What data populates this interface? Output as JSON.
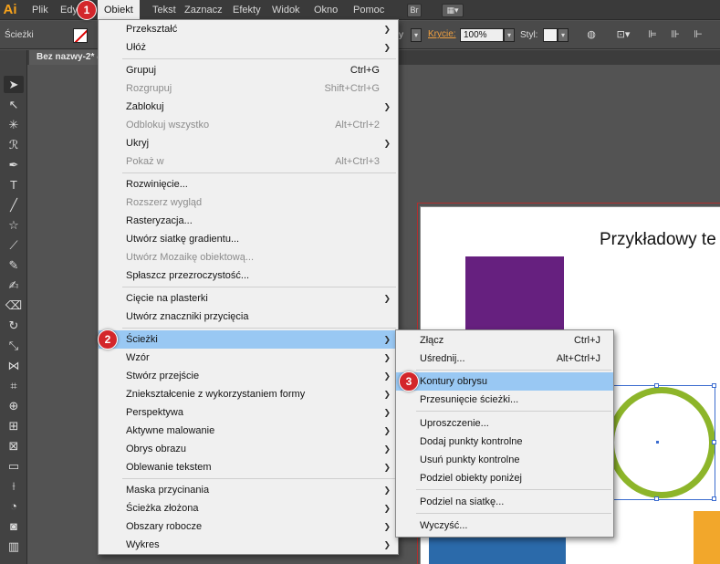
{
  "app": {
    "logo": "Ai"
  },
  "menubar": {
    "items": [
      "Plik",
      "Edy",
      "Obiekt",
      "Tekst",
      "Zaznacz",
      "Efekty",
      "Widok",
      "Okno",
      "Pomoc"
    ],
    "br_label": "Br"
  },
  "control_bar": {
    "mode_label": "Ścieżki",
    "opacity_label": "Krycie:",
    "opacity_value": "100%",
    "style_label": "Styl:",
    "y_fragment": "y"
  },
  "document": {
    "tab_title": "Bez nazwy-2* @"
  },
  "artboard": {
    "sample_text": "Przykładowy te"
  },
  "colors": {
    "purple": "#66207f",
    "green_ring": "#8db52a",
    "blue": "#2b6aaa",
    "orange": "#f2a72b",
    "menu_highlight": "#99c8f3",
    "badge": "#d3262b"
  },
  "badges": [
    "1",
    "2",
    "3"
  ],
  "object_menu": [
    {
      "label": "Przekształć",
      "submenu": true
    },
    {
      "label": "Ułóż",
      "submenu": true
    },
    {
      "label": "Grupuj",
      "shortcut": "Ctrl+G"
    },
    {
      "label": "Rozgrupuj",
      "shortcut": "Shift+Ctrl+G",
      "disabled": true
    },
    {
      "label": "Zablokuj",
      "submenu": true
    },
    {
      "label": "Odblokuj wszystko",
      "shortcut": "Alt+Ctrl+2",
      "disabled": true
    },
    {
      "label": "Ukryj",
      "submenu": true
    },
    {
      "label": "Pokaż w",
      "shortcut": "Alt+Ctrl+3",
      "disabled": true
    },
    {
      "label": "Rozwinięcie..."
    },
    {
      "label": "Rozszerz wygląd",
      "disabled": true
    },
    {
      "label": "Rasteryzacja..."
    },
    {
      "label": "Utwórz siatkę gradientu..."
    },
    {
      "label": "Utwórz Mozaikę obiektową...",
      "disabled": true
    },
    {
      "label": "Spłaszcz przezroczystość..."
    },
    {
      "label": "Cięcie na plasterki",
      "submenu": true
    },
    {
      "label": "Utwórz znaczniki przycięcia"
    },
    {
      "label": "Ścieżki",
      "submenu": true,
      "highlighted": true
    },
    {
      "label": "Wzór",
      "submenu": true
    },
    {
      "label": "Stwórz przejście",
      "submenu": true
    },
    {
      "label": "Zniekształcenie z wykorzystaniem formy",
      "submenu": true
    },
    {
      "label": "Perspektywa",
      "submenu": true
    },
    {
      "label": "Aktywne malowanie",
      "submenu": true
    },
    {
      "label": "Obrys obrazu",
      "submenu": true
    },
    {
      "label": "Oblewanie tekstem",
      "submenu": true
    },
    {
      "label": "Maska przycinania",
      "submenu": true
    },
    {
      "label": "Ścieżka złożona",
      "submenu": true
    },
    {
      "label": "Obszary robocze",
      "submenu": true
    },
    {
      "label": "Wykres",
      "submenu": true
    }
  ],
  "paths_submenu": [
    {
      "label": "Złącz",
      "shortcut": "Ctrl+J"
    },
    {
      "label": "Uśrednij...",
      "shortcut": "Alt+Ctrl+J"
    },
    {
      "label": "Kontury obrysu",
      "highlighted": true
    },
    {
      "label": "Przesunięcie ścieżki..."
    },
    {
      "label": "Uproszczenie..."
    },
    {
      "label": "Dodaj punkty kontrolne"
    },
    {
      "label": "Usuń punkty kontrolne"
    },
    {
      "label": "Podziel obiekty poniżej"
    },
    {
      "label": "Podziel na siatkę..."
    },
    {
      "label": "Wyczyść..."
    }
  ],
  "tools": [
    "selection-tool",
    "direct-selection-tool",
    "magic-wand-tool",
    "lasso-tool",
    "pen-tool",
    "type-tool",
    "line-tool",
    "star-tool",
    "paintbrush-tool",
    "pencil-tool",
    "blob-brush-tool",
    "eraser-tool",
    "rotate-tool",
    "scale-tool",
    "width-tool",
    "free-transform-tool",
    "shape-builder-tool",
    "perspective-grid-tool",
    "mesh-tool",
    "gradient-tool",
    "eyedropper-tool",
    "blend-tool",
    "symbol-sprayer-tool",
    "column-graph-tool",
    "artboard-tool"
  ]
}
